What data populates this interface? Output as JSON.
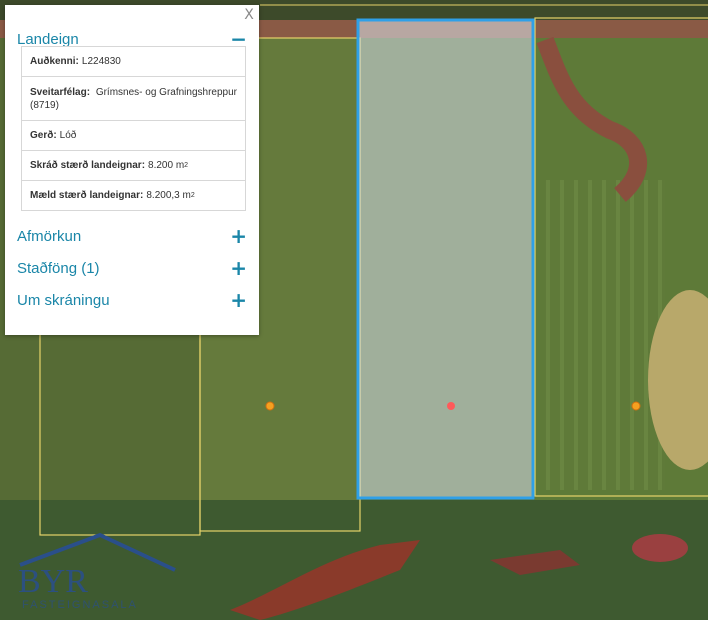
{
  "panel": {
    "close_label": "X",
    "sections": {
      "landeign": {
        "title": "Landeign",
        "icon": "minus-icon",
        "rows": [
          {
            "label": "Auðkenni:",
            "value": "L224830"
          },
          {
            "label": "Sveitarfélag:",
            "value": "Grímsnes- og Grafningshreppur (8719)"
          },
          {
            "label": "Gerð:",
            "value": "Lóð"
          },
          {
            "label": "Skráð stærð landeignar:",
            "value": "8.200 m",
            "unit_sup": "2"
          },
          {
            "label": "Mæld stærð landeignar:",
            "value": "8.200,3 m",
            "unit_sup": "2"
          }
        ]
      },
      "afmorkun": {
        "title": "Afmörkun",
        "icon": "plus-icon"
      },
      "stadfong": {
        "title": "Staðföng (1)",
        "icon": "plus-icon"
      },
      "um": {
        "title": "Um skráningu",
        "icon": "plus-icon"
      }
    }
  },
  "logo": {
    "text": "BYR",
    "subtext": "FASTEIGNASALA"
  },
  "colors": {
    "accent": "#1a86a8",
    "parcel_border": "#e6d36a",
    "selected_border": "#2fa0e8",
    "marker_selected": "#ff5a5a",
    "marker": "#f5a020"
  }
}
